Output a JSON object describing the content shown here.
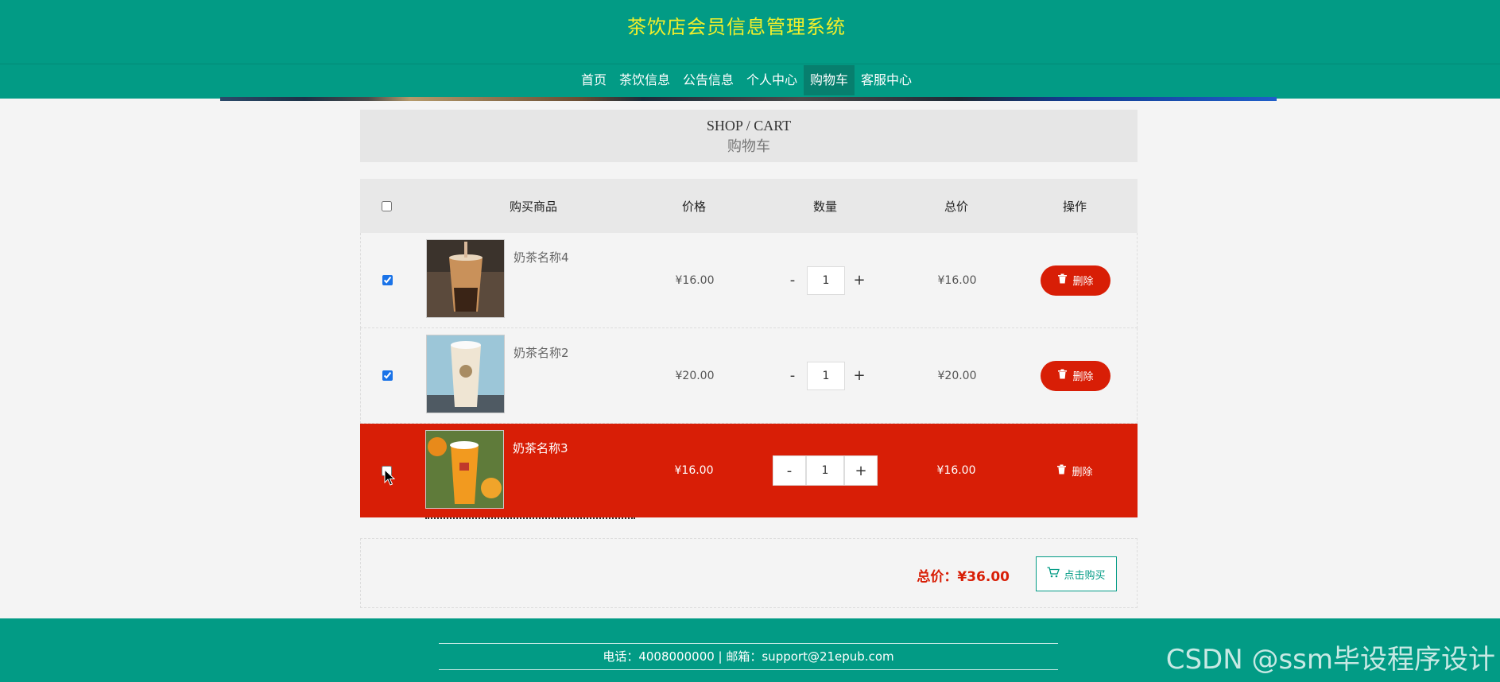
{
  "site": {
    "title": "茶饮店会员信息管理系统"
  },
  "nav": {
    "items": [
      "首页",
      "茶饮信息",
      "公告信息",
      "个人中心",
      "购物车",
      "客服中心"
    ],
    "active": "购物车"
  },
  "section": {
    "en": "SHOP / CART",
    "cn": "购物车"
  },
  "table": {
    "headers": {
      "product": "购买商品",
      "price": "价格",
      "qty": "数量",
      "total": "总价",
      "op": "操作"
    },
    "rows": [
      {
        "name": "奶茶名称4",
        "price": "¥16.00",
        "qty": "1",
        "total": "¥16.00",
        "checked": true,
        "highlight": false,
        "minus": "-",
        "plus": "+",
        "delete": "删除"
      },
      {
        "name": "奶茶名称2",
        "price": "¥20.00",
        "qty": "1",
        "total": "¥20.00",
        "checked": true,
        "highlight": false,
        "minus": "-",
        "plus": "+",
        "delete": "删除"
      },
      {
        "name": "奶茶名称3",
        "price": "¥16.00",
        "qty": "1",
        "total": "¥16.00",
        "checked": false,
        "highlight": true,
        "minus": "-",
        "plus": "+",
        "delete": "删除"
      }
    ]
  },
  "summary": {
    "label": "总价：",
    "amount": "¥36.00",
    "buy_label": "点击购买"
  },
  "footer": {
    "contact": "电话：4008000000 | 邮箱：support@21epub.com"
  },
  "watermark": "CSDN @ssm毕设程序设计",
  "colors": {
    "primary": "#029b85",
    "title": "#f3ef2a",
    "danger": "#d81e06"
  }
}
